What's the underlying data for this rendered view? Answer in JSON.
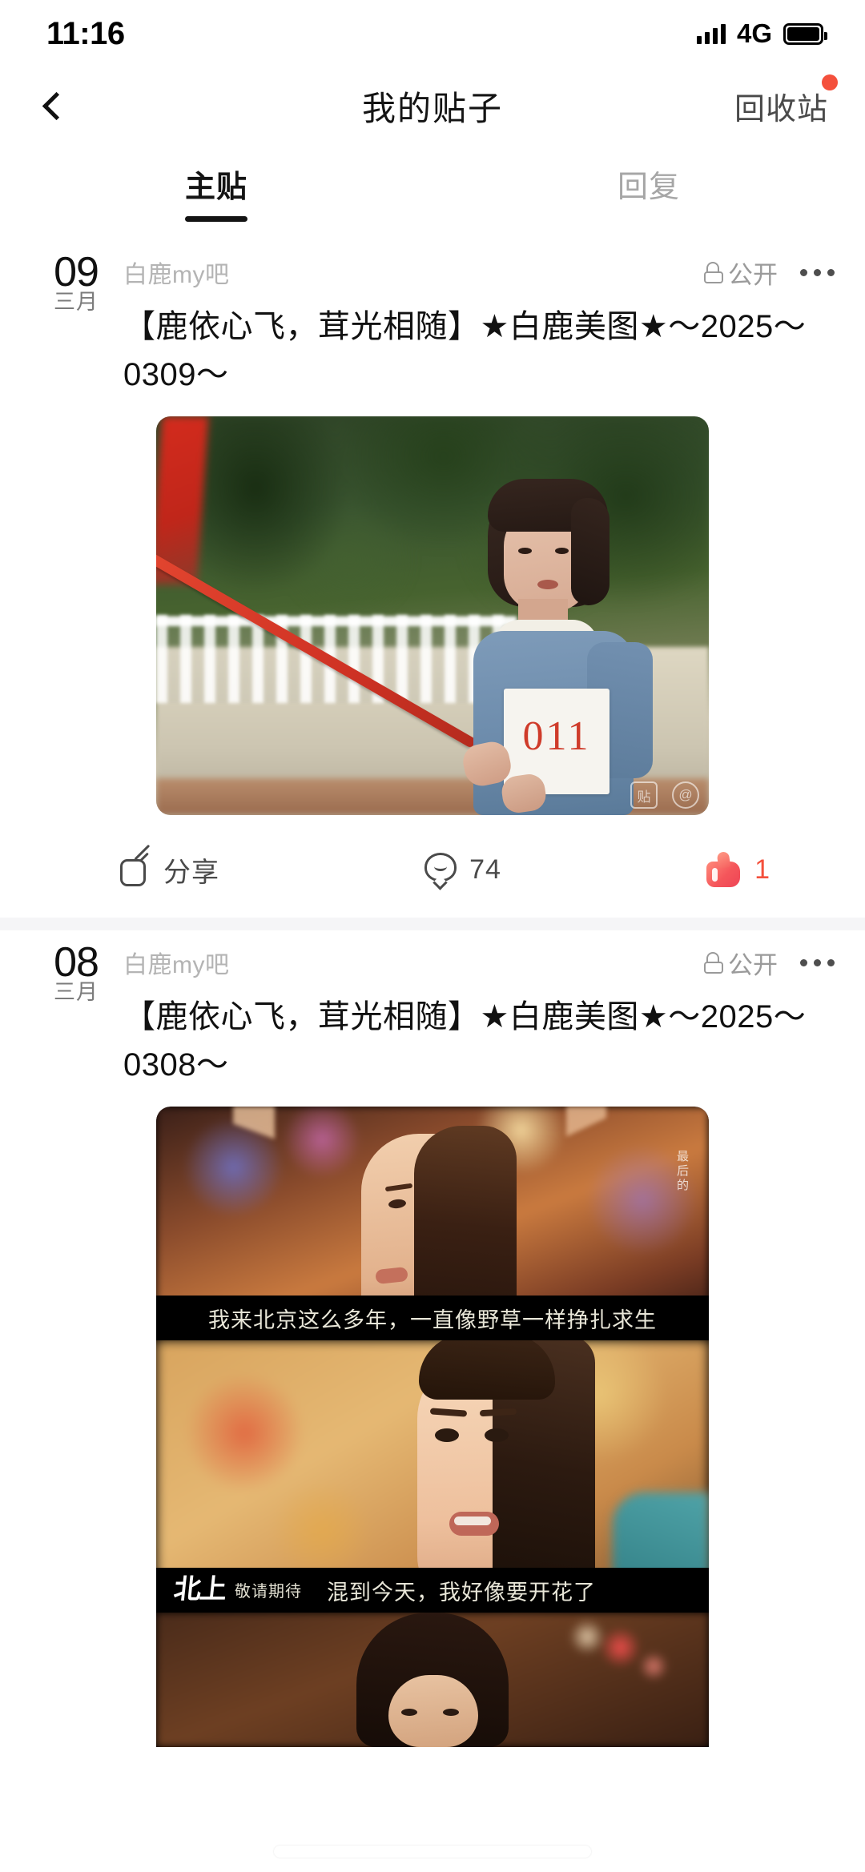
{
  "status_bar": {
    "time": "11:16",
    "network": "4G",
    "signal_icon": "signal-bars-icon",
    "battery_icon": "battery-icon"
  },
  "header": {
    "back_icon": "back-chevron-icon",
    "title": "我的贴子",
    "right_action": "回收站",
    "badge_color": "#f4503c"
  },
  "tabs": [
    {
      "label": "主贴",
      "active": true
    },
    {
      "label": "回复",
      "active": false
    }
  ],
  "posts": [
    {
      "day": "09",
      "month": "三月",
      "forum": "白鹿my吧",
      "privacy": "公开",
      "privacy_icon": "unlock-icon",
      "more_icon": "more-dots-icon",
      "title": "【鹿依心飞，茸光相随】★白鹿美图★～2025～0309～",
      "image_alt": "女子穿蓝色运动衫手持红色标枪，胸前号码布 011",
      "bib_number": "011",
      "watermark_1": "贴",
      "watermark_2": "@",
      "actions": {
        "share_label": "分享",
        "share_icon": "share-edit-icon",
        "comment_count": "74",
        "comment_icon": "comment-bubble-icon",
        "like_count": "1",
        "like_icon": "thumbs-up-icon",
        "like_color": "#f4503c"
      }
    },
    {
      "day": "08",
      "month": "三月",
      "forum": "白鹿my吧",
      "privacy": "公开",
      "privacy_icon": "unlock-icon",
      "more_icon": "more-dots-icon",
      "title": "【鹿依心飞，茸光相随】★白鹿美图★～2025～0308～",
      "frames": [
        {
          "alt": "人群中仰望的女子特写",
          "side_text": "最后的",
          "subtitle": "我来北京这么多年，一直像野草一样挣扎求生"
        },
        {
          "alt": "女子面部特写",
          "logo_mark": "北上",
          "logo_sub": "敬请期待",
          "subtitle": "混到今天，我好像要开花了"
        },
        {
          "alt": "夜景中的女子剪影"
        }
      ]
    }
  ],
  "home_indicator": "home-indicator"
}
